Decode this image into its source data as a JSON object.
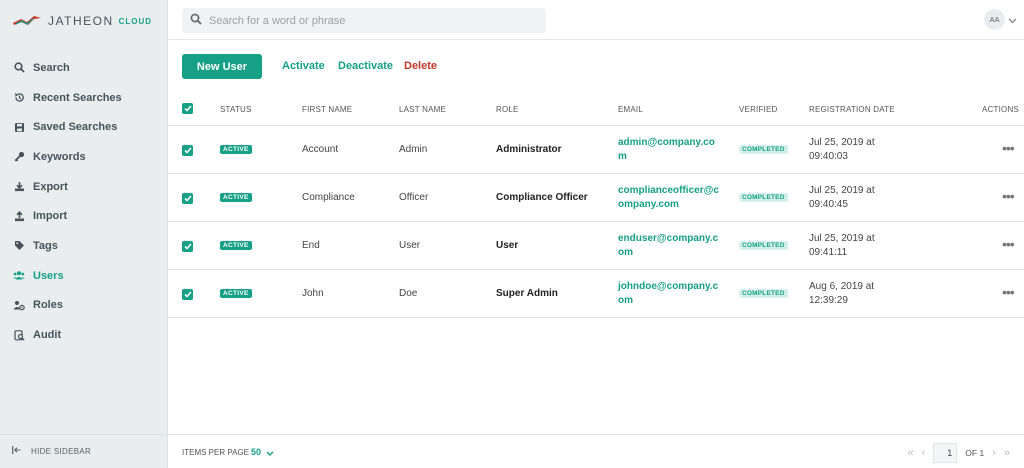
{
  "brand": {
    "name": "JATHEON",
    "suffix": "CLOUD"
  },
  "search": {
    "placeholder": "Search for a word or phrase"
  },
  "user": {
    "initials": "AA"
  },
  "sidebar": {
    "items": [
      {
        "label": "Search",
        "icon": "search-icon"
      },
      {
        "label": "Recent Searches",
        "icon": "history-icon"
      },
      {
        "label": "Saved Searches",
        "icon": "save-icon"
      },
      {
        "label": "Keywords",
        "icon": "key-icon"
      },
      {
        "label": "Export",
        "icon": "export-icon"
      },
      {
        "label": "Import",
        "icon": "import-icon"
      },
      {
        "label": "Tags",
        "icon": "tag-icon"
      },
      {
        "label": "Users",
        "icon": "users-icon",
        "active": true
      },
      {
        "label": "Roles",
        "icon": "roles-icon"
      },
      {
        "label": "Audit",
        "icon": "audit-icon"
      }
    ],
    "hide_label": "HIDE SIDEBAR"
  },
  "toolbar": {
    "new_user": "New User",
    "activate": "Activate",
    "deactivate": "Deactivate",
    "delete": "Delete"
  },
  "table": {
    "headers": {
      "status": "STATUS",
      "first_name": "FIRST NAME",
      "last_name": "LAST NAME",
      "role": "ROLE",
      "email": "EMAIL",
      "verified": "VERIFIED",
      "registration_date": "REGISTRATION DATE",
      "actions": "ACTIONS"
    },
    "rows": [
      {
        "status": "ACTIVE",
        "first": "Account",
        "last": "Admin",
        "role": "Administrator",
        "email": "admin@company.com",
        "verified": "COMPLETED",
        "reg": "Jul 25, 2019 at 09:40:03"
      },
      {
        "status": "ACTIVE",
        "first": "Compliance",
        "last": "Officer",
        "role": "Compliance Officer",
        "email": "complianceofficer@company.com",
        "verified": "COMPLETED",
        "reg": "Jul 25, 2019 at 09:40:45"
      },
      {
        "status": "ACTIVE",
        "first": "End",
        "last": "User",
        "role": "User",
        "email": "enduser@company.com",
        "verified": "COMPLETED",
        "reg": "Jul 25, 2019 at 09:41:11"
      },
      {
        "status": "ACTIVE",
        "first": "John",
        "last": "Doe",
        "role": "Super Admin",
        "email": "johndoe@company.com",
        "verified": "COMPLETED",
        "reg": "Aug 6, 2019 at 12:39:29"
      }
    ]
  },
  "footer": {
    "items_per_page_label": "ITEMS PER PAGE",
    "items_per_page_value": "50",
    "current_page": "1",
    "of_label": "OF 1"
  },
  "colors": {
    "accent": "#16a085",
    "danger": "#c0392b",
    "sidebar_bg": "#e9edee"
  }
}
